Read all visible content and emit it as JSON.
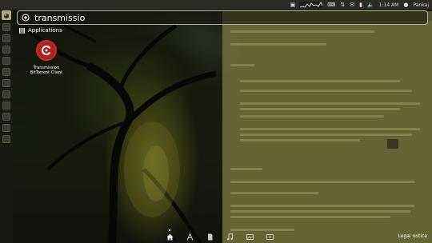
{
  "top_panel": {
    "clock": "1:14 AM",
    "user": "Pankaj"
  },
  "launcher": {
    "item_count": 12
  },
  "dash": {
    "search_value": "transmissio",
    "category_label": "Applications",
    "result": {
      "name_line1": "Transmission",
      "name_line2": "BitTorrent Client",
      "icon": "transmission-icon"
    },
    "lenses": [
      "home-lens-icon",
      "applications-lens-icon",
      "files-lens-icon",
      "music-lens-icon",
      "photos-lens-icon",
      "video-lens-icon"
    ],
    "legal_notice": "Legal notice"
  },
  "colors": {
    "panel": "#2b2a24",
    "search_border": "#b9b5a3",
    "transmission_red": "#b0211f"
  }
}
